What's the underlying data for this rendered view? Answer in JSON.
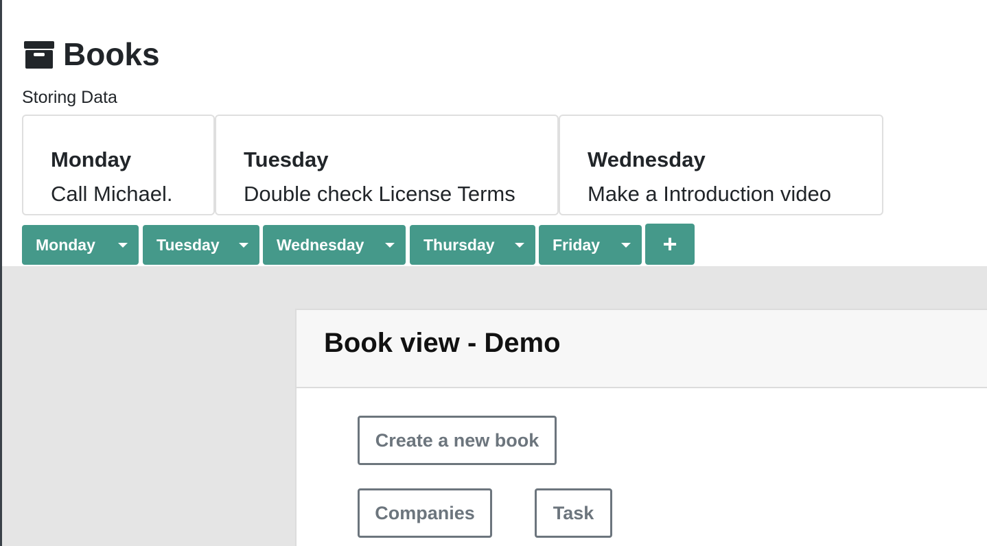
{
  "header": {
    "title": "Books",
    "icon": "archive-box-icon",
    "subtitle": "Storing Data"
  },
  "cards": [
    {
      "day": "Monday",
      "task": "Call Michael."
    },
    {
      "day": "Tuesday",
      "task": "Double check License Terms"
    },
    {
      "day": "Wednesday",
      "task": "Make a Introduction video"
    }
  ],
  "tabs": [
    {
      "label": "Monday"
    },
    {
      "label": "Tuesday"
    },
    {
      "label": "Wednesday"
    },
    {
      "label": "Thursday"
    },
    {
      "label": "Friday"
    }
  ],
  "add_tab": {
    "icon": "plus-icon",
    "symbol": "+"
  },
  "panel": {
    "title": "Book view - Demo",
    "buttons": {
      "create": "Create a new book",
      "companies": "Companies",
      "task": "Task"
    }
  },
  "colors": {
    "tab_bg": "#45998a",
    "button_border": "#6c757d",
    "grey_area": "#e5e5e5"
  }
}
